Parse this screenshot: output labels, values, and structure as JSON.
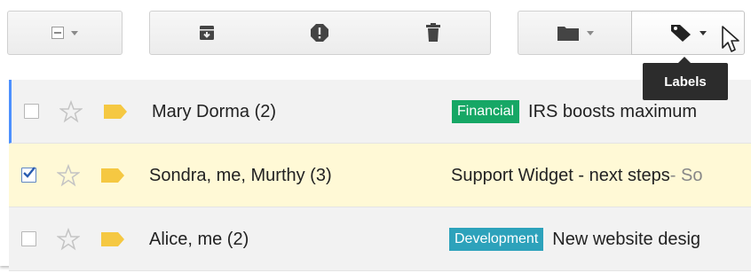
{
  "toolbar": {
    "select_label": "",
    "move_label": "",
    "labels_label": ""
  },
  "tooltip": {
    "text": "Labels"
  },
  "rows": [
    {
      "sender": "Mary Dorma (2)",
      "label": "Financial",
      "label_color": "#16a765",
      "subject": "IRS boosts maximum",
      "snippet": "",
      "checked": false,
      "starred": false
    },
    {
      "sender": "Sondra, me, Murthy (3)",
      "label": "",
      "subject": "Support Widget - next steps",
      "snippet": " - So",
      "checked": true,
      "starred": false
    },
    {
      "sender": "Alice, me (2)",
      "label": "Development",
      "label_color": "#2da2bb",
      "subject": "New website desig",
      "snippet": "",
      "checked": false,
      "starred": false
    }
  ],
  "colors": {
    "accent": "#4d90fe",
    "selected_row": "#fff9d6",
    "important_tag": "#f5c842"
  }
}
